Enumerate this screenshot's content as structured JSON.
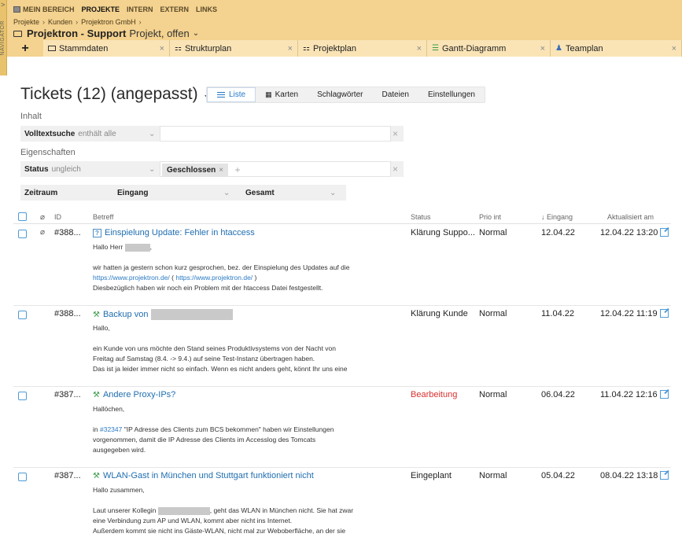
{
  "navigator": {
    "label": "NAVIGATOR",
    "chevron": ">"
  },
  "topnav": [
    "MEIN BEREICH",
    "PROJEKTE",
    "INTERN",
    "EXTERN",
    "LINKS"
  ],
  "breadcrumb": [
    "Projekte",
    "Kunden",
    "Projektron GmbH"
  ],
  "project": {
    "name": "Projektron - Support",
    "type": "Projekt, offen"
  },
  "tabs": [
    {
      "label": "Stammdaten",
      "icon": "folder-icon"
    },
    {
      "label": "Strukturplan",
      "icon": "structure-icon"
    },
    {
      "label": "Projektplan",
      "icon": "structure-icon"
    },
    {
      "label": "Gantt-Diagramm",
      "icon": "gantt-icon"
    },
    {
      "label": "Teamplan",
      "icon": "team-icon"
    }
  ],
  "page": {
    "title": "Tickets (12) (angepasst)"
  },
  "viewtabs": [
    "Liste",
    "Karten",
    "Schlagwörter",
    "Dateien",
    "Einstellungen"
  ],
  "filters": {
    "inhalt_label": "Inhalt",
    "volltext": {
      "name": "Volltextsuche",
      "op": "enthält alle",
      "value": ""
    },
    "eigenschaften_label": "Eigenschaften",
    "status": {
      "name": "Status",
      "op": "ungleich",
      "chip": "Geschlossen"
    },
    "zeitraum": {
      "name": "Zeitraum",
      "field": "Eingang",
      "range": "Gesamt"
    }
  },
  "columns": {
    "id": "ID",
    "betreff": "Betreff",
    "status": "Status",
    "prio": "Prio int",
    "eingang": "↓ Eingang",
    "aktualisiert": "Aktualisiert am"
  },
  "tickets": [
    {
      "id": "#388...",
      "subject": "Einspielung Update: Fehler in htaccess",
      "status": "Klärung Suppo...",
      "prio": "Normal",
      "eingang": "12.04.22",
      "aktualisiert": "12.04.22 13:20",
      "greeting": "Hallo Herr",
      "body1": "wir hatten ja gestern schon kurz gesprochen, bez. der Einspielung des Updates auf die",
      "link": "https://www.projektron.de/",
      "body2": "Diesbezüglich haben wir noch ein Problem mit der htaccess Datei festgestellt."
    },
    {
      "id": "#388...",
      "subject": "Backup von",
      "status": "Klärung Kunde",
      "prio": "Normal",
      "eingang": "11.04.22",
      "aktualisiert": "12.04.22 11:19",
      "greeting": "Hallo,",
      "body1": "ein Kunde von uns möchte den Stand seines Produktivsystems von der Nacht von",
      "body2": "Freitag auf Samstag (8.4. -> 9.4.) auf seine Test-Instanz übertragen haben.",
      "body3": "Das ist ja leider immer nicht so einfach. Wenn es nicht anders geht, könnt Ihr uns eine"
    },
    {
      "id": "#387...",
      "subject": "Andere Proxy-IPs?",
      "status": "Bearbeitung",
      "prio": "Normal",
      "eingang": "06.04.22",
      "aktualisiert": "11.04.22 12:16",
      "greeting": "Hallöchen,",
      "body1_prefix": "in",
      "body1_link": "#32347",
      "body1_rest": "\"IP Adresse des Clients zum BCS bekommen\" haben wir Einstellungen",
      "body2": "vorgenommen, damit die IP Adresse des Clients im Accesslog des Tomcats",
      "body3": "ausgegeben wird."
    },
    {
      "id": "#387...",
      "subject": "WLAN-Gast in München und Stuttgart funktioniert nicht",
      "status": "Eingeplant",
      "prio": "Normal",
      "eingang": "05.04.22",
      "aktualisiert": "08.04.22 13:18",
      "greeting": "Hallo zusammen,",
      "body1_prefix": "Laut unserer Kollegin",
      "body1_rest": ", geht das WLAN in München nicht. Sie hat zwar",
      "body2": "eine Verbindung zum AP und WLAN, kommt aber nicht ins Internet.",
      "body3": "Außerdem kommt sie nicht ins Gäste-WLAN, nicht mal zur Weboberfläche, an der sie"
    }
  ],
  "colors": {
    "header": "#f4d28f",
    "accent": "#2279c9",
    "status_red": "#d9302f"
  }
}
